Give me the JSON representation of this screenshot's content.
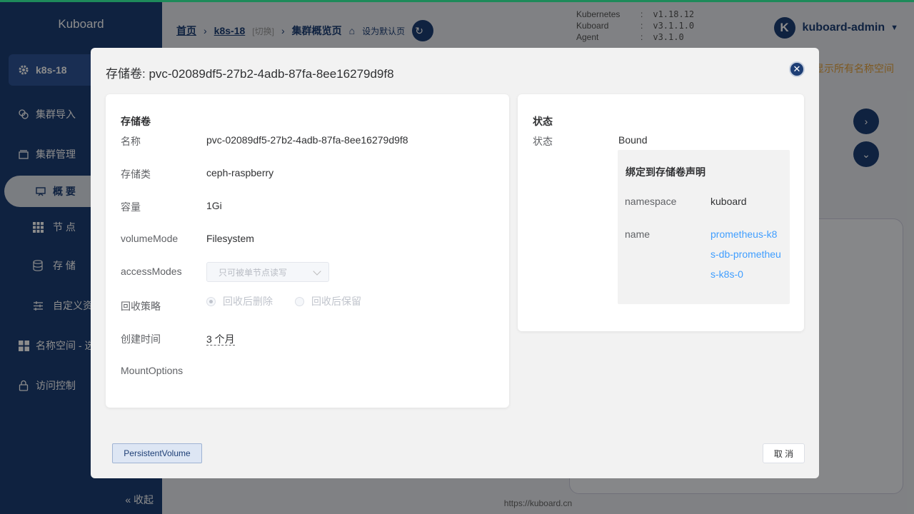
{
  "colors": {
    "sidebar": "#1d3e75",
    "accent": "#409eff",
    "orange": "#e6a23c",
    "top_stripe": "#1e8a5a"
  },
  "sidebar": {
    "logo": "Kuboard",
    "cluster": "k8s-18",
    "items": [
      {
        "label": "集群导入",
        "icon": "import-icon"
      },
      {
        "label": "集群管理",
        "icon": "cluster-icon"
      },
      {
        "label": "概 要",
        "icon": "overview-icon"
      },
      {
        "label": "节 点",
        "icon": "grid-icon"
      },
      {
        "label": "存 储",
        "icon": "database-icon"
      },
      {
        "label": "自定义资",
        "icon": "sliders-icon"
      },
      {
        "label": "名称空间 - 选",
        "icon": "apps-icon"
      },
      {
        "label": "访问控制",
        "icon": "lock-icon"
      }
    ],
    "collapse": "« 收起"
  },
  "header": {
    "breadcrumb": {
      "home": "首页",
      "cluster": "k8s-18",
      "switch": "[切换]",
      "page": "集群概览页",
      "set_default": "设为默认页"
    },
    "versions": [
      {
        "name": "Kubernetes",
        "value": "v1.18.12"
      },
      {
        "name": "Kuboard",
        "value": "v3.1.1.0"
      },
      {
        "name": "Agent",
        "value": "v3.1.0"
      }
    ],
    "user_initial": "K",
    "user": "kuboard-admin"
  },
  "background": {
    "orange_text": "显示所有名称空间",
    "footer": "https://kuboard.cn"
  },
  "modal": {
    "title": "存储卷: pvc-02089df5-27b2-4adb-87fa-8ee16279d9f8",
    "left": {
      "heading": "存储卷",
      "name_label": "名称",
      "name": "pvc-02089df5-27b2-4adb-87fa-8ee16279d9f8",
      "storage_class_label": "存储类",
      "storage_class": "ceph-raspberry",
      "capacity_label": "容量",
      "capacity": "1Gi",
      "volume_mode_label": "volumeMode",
      "volume_mode": "Filesystem",
      "access_modes_label": "accessModes",
      "access_modes": "只可被单节点读写",
      "reclaim_label": "回收策略",
      "reclaim_delete": "回收后删除",
      "reclaim_retain": "回收后保留",
      "created_label": "创建时间",
      "created": "3 个月",
      "mount_options_label": "MountOptions"
    },
    "right": {
      "heading": "状态",
      "status_label": "状态",
      "status": "Bound",
      "claim_heading": "绑定到存储卷声明",
      "namespace_label": "namespace",
      "namespace": "kuboard",
      "name_label": "name",
      "name": "prometheus-k8s-db-prometheus-k8s-0"
    },
    "tag_button": "PersistentVolume",
    "cancel_button": "取 消"
  }
}
